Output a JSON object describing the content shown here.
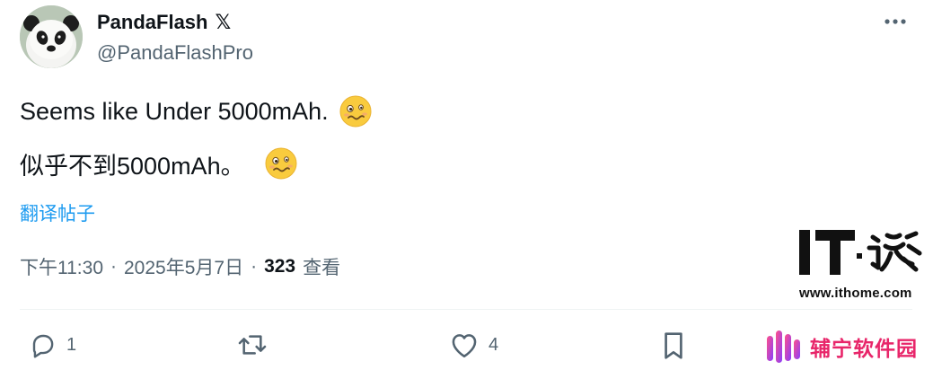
{
  "author": {
    "display_name": "PandaFlash",
    "badge": "𝕏",
    "handle": "@PandaFlashPro",
    "avatar": "panda-avatar"
  },
  "tweet": {
    "line_en": "Seems like Under 5000mAh.",
    "line_zh": "似乎不到5000mAh。",
    "emoji": "woozy-face-emoji"
  },
  "translate_label": "翻译帖子",
  "meta": {
    "time": "下午11:30",
    "separator": "·",
    "date": "2025年5月7日",
    "views_count": "323",
    "views_label": "查看"
  },
  "actions": {
    "replies": "1",
    "likes": "4"
  },
  "watermarks": {
    "ithome_logo": "IT之家",
    "ithome_url": "www.ithome.com",
    "brand_text": "辅宁软件园"
  },
  "colors": {
    "link": "#1d9bf0",
    "muted": "#536471",
    "text": "#0f1419",
    "brand": "#e8266a"
  }
}
